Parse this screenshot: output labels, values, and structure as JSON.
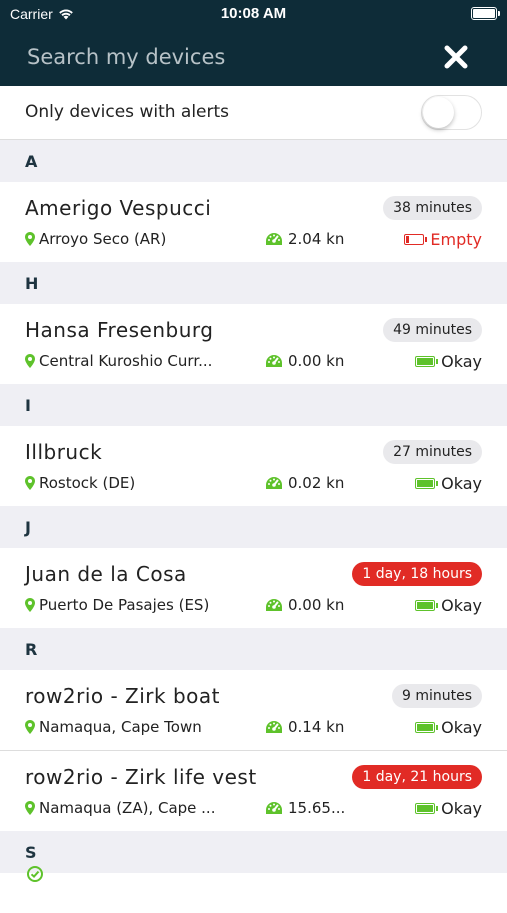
{
  "status_bar": {
    "carrier": "Carrier",
    "time": "10:08 AM"
  },
  "search": {
    "placeholder": "Search my devices"
  },
  "filter": {
    "label": "Only devices with alerts",
    "toggle_on": false
  },
  "sections": [
    {
      "letter": "A",
      "devices": [
        {
          "name": "Amerigo Vespucci",
          "elapsed": "38 minutes",
          "alert": false,
          "location": "Arroyo Seco (AR)",
          "speed": "2.04 kn",
          "battery": "Empty"
        }
      ]
    },
    {
      "letter": "H",
      "devices": [
        {
          "name": "Hansa Fresenburg",
          "elapsed": "49 minutes",
          "alert": false,
          "location": "Central Kuroshio Curr...",
          "speed": "0.00 kn",
          "battery": "Okay"
        }
      ]
    },
    {
      "letter": "I",
      "devices": [
        {
          "name": "Illbruck",
          "elapsed": "27 minutes",
          "alert": false,
          "location": "Rostock (DE)",
          "speed": "0.02 kn",
          "battery": "Okay"
        }
      ]
    },
    {
      "letter": "J",
      "devices": [
        {
          "name": "Juan de la Cosa",
          "elapsed": "1 day, 18 hours",
          "alert": true,
          "location": "Puerto De Pasajes (ES)",
          "speed": "0.00 kn",
          "battery": "Okay"
        }
      ]
    },
    {
      "letter": "R",
      "devices": [
        {
          "name": "row2rio - Zirk boat",
          "elapsed": "9 minutes",
          "alert": false,
          "location": "Namaqua, Cape Town",
          "speed": "0.14 kn",
          "battery": "Okay"
        },
        {
          "name": "row2rio - Zirk life vest",
          "elapsed": "1 day, 21 hours",
          "alert": true,
          "location": "Namaqua (ZA), Cape ...",
          "speed": "15.65...",
          "battery": "Okay"
        }
      ]
    },
    {
      "letter": "S",
      "devices": []
    }
  ],
  "colors": {
    "header_bg": "#0e2c38",
    "accent_green": "#5ec22b",
    "alert_red": "#e12b25",
    "section_bg": "#efeff4"
  },
  "icons": {
    "close": "close-icon",
    "pin": "map-pin-icon",
    "speed": "speedometer-icon",
    "battery": "battery-icon",
    "wifi": "wifi-icon"
  }
}
